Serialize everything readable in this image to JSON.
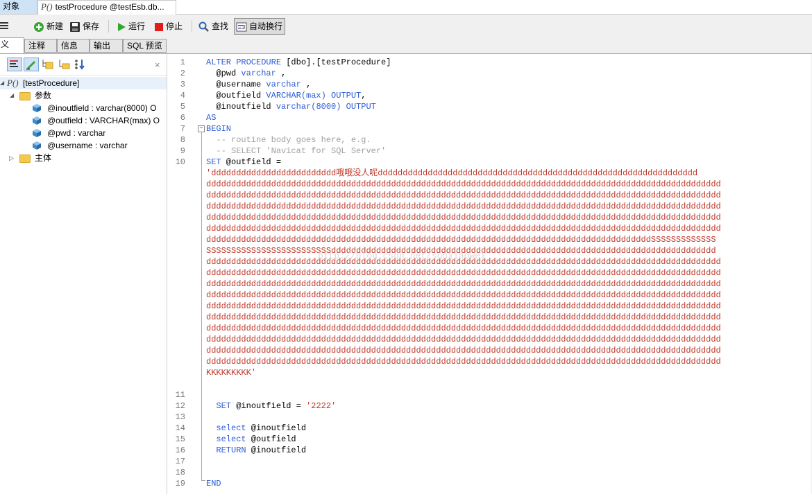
{
  "tabs": {
    "objects": "对象",
    "procedure_prefix": "P()",
    "procedure": "testProcedure @testEsb.db..."
  },
  "toolbar": {
    "new": "新建",
    "save": "保存",
    "run": "运行",
    "stop": "停止",
    "find": "查找",
    "wrap": "自动换行"
  },
  "subtabs": [
    "义",
    "注释",
    "信息",
    "输出",
    "SQL 预览"
  ],
  "tree": {
    "close": "×",
    "root_prefix": "P()",
    "root": "[testProcedure]",
    "params_folder": "参数",
    "params": [
      "@inoutfield : varchar(8000) O",
      "@outfield : VARCHAR(max) O",
      "@pwd : varchar",
      "@username : varchar"
    ],
    "body_folder": "主体"
  },
  "editor": {
    "line_numbers": [
      "1",
      "2",
      "3",
      "4",
      "5",
      "6",
      "7",
      "8",
      "9",
      "10",
      "11",
      "12",
      "13",
      "14",
      "15",
      "16",
      "17",
      "18",
      "19"
    ],
    "code": {
      "l1_kw": "ALTER PROCEDURE",
      "l1_rest": " [dbo].[testProcedure]",
      "l2_a": "  @pwd ",
      "l2_kw": "varchar",
      "l2_b": " ,",
      "l3_a": "  @username ",
      "l3_kw": "varchar",
      "l3_b": " ,",
      "l4_a": "  @outfield ",
      "l4_kw": "VARCHAR(max) OUTPUT",
      "l4_b": ",",
      "l5_a": "  @inoutfield ",
      "l5_kw": "varchar(8000) OUTPUT",
      "l6": "AS",
      "l7": "BEGIN",
      "l8": "  -- routine body goes here, e.g.",
      "l9": "  -- SELECT 'Navicat for SQL Server'",
      "l10_kw": "SET",
      "l10_rest": " @outfield =",
      "l12_kw": "  SET",
      "l12_a": " @inoutfield = ",
      "l12_str": "'2222'",
      "l14_kw": "  select",
      "l14_rest": " @inoutfield",
      "l15_kw": "  select",
      "l15_rest": " @outfield",
      "l16_kw": "  RETURN",
      "l16_rest": " @inoutfield",
      "l19": "END"
    },
    "string_lines": [
      "'ddddddddddddddddddddddddd哦哦没人呢dddddddddddddddddddddddddddddddddddddddddddddddddddddddddddddddd",
      "ddddddddddddddddddddddddddddddddddddddddddddddddddddddddddddddddddddddddddddddddddddddddddddddddddddddd",
      "ddddddddddddddddddddddddddddddddddddddddddddddddddddddddddddddddddddddddddddddddddddddddddddddddddddddd",
      "ddddddddddddddddddddddddddddddddddddddddddddddddddddddddddddddddddddddddddddddddddddddddddddddddddddddd",
      "ddddddddddddddddddddddddddddddddddddddddddddddddddddddddddddddddddddddddddddddddddddddddddddddddddddddd",
      "ddddddddddddddddddddddddddddddddddddddddddddddddddddddddddddddddddddddddddddddddddddddddddddddddddddddd",
      "dddddddddddddddddddddddddddddddddddddddddddddddddddddddddddddddddddddddddddddddddddddddddSSSSSSSSSSSSS",
      "SSSSSSSSSSSSSSSSSSSSSSSSSddddddddddddddddddddddddddddddddddddddddddddddddddddddddddddddddddddddddddddd",
      "ddddddddddddddddddddddddddddddddddddddddddddddddddddddddddddddddddddddddddddddddddddddddddddddddddddddd",
      "ddddddddddddddddddddddddddddddddddddddddddddddddddddddddddddddddddddddddddddddddddddddddddddddddddddddd",
      "ddddddddddddddddddddddddddddddddddddddddddddddddddddddddddddddddddddddddddddddddddddddddddddddddddddddd",
      "ddddddddddddddddddddddddddddddddddddddddddddddddddddddddddddddddddddddddddddddddddddddddddddddddddddddd",
      "ddddddddddddddddddddddddddddddddddddddddddddddddddddddddddddddddddddddddddddddddddddddddddddddddddddddd",
      "ddddddddddddddddddddddddddddddddddddddddddddddddddddddddddddddddddddddddddddddddddddddddddddddddddddddd",
      "ddddddddddddddddddddddddddddddddddddddddddddddddddddddddddddddddddddddddddddddddddddddddddddddddddddddd",
      "ddddddddddddddddddddddddddddddddddddddddddddddddddddddddddddddddddddddddddddddddddddddddddddddddddddddd",
      "ddddddddddddddddddddddddddddddddddddddddddddddddddddddddddddddddddddddddddddddddddddddddddddddddddddddd",
      "ddddddddddddddddddddddddddddddddddddddddddddddddddddddddddddddddddddddddddddddddddddddddddddddddddddddd",
      "KKKKKKKKK'"
    ],
    "watermark": "http://blog.csdn.net/sunxiaowei"
  },
  "colors": {
    "keyword": "#2b5bd6",
    "string": "#c0392b",
    "comment": "#a0a0a0",
    "active_tab": "#cfe3f7"
  },
  "icons": [
    "menu-icon",
    "new-icon",
    "save-icon",
    "run-icon",
    "stop-icon",
    "find-icon",
    "wrap-icon",
    "folder-icon",
    "param-icon"
  ]
}
